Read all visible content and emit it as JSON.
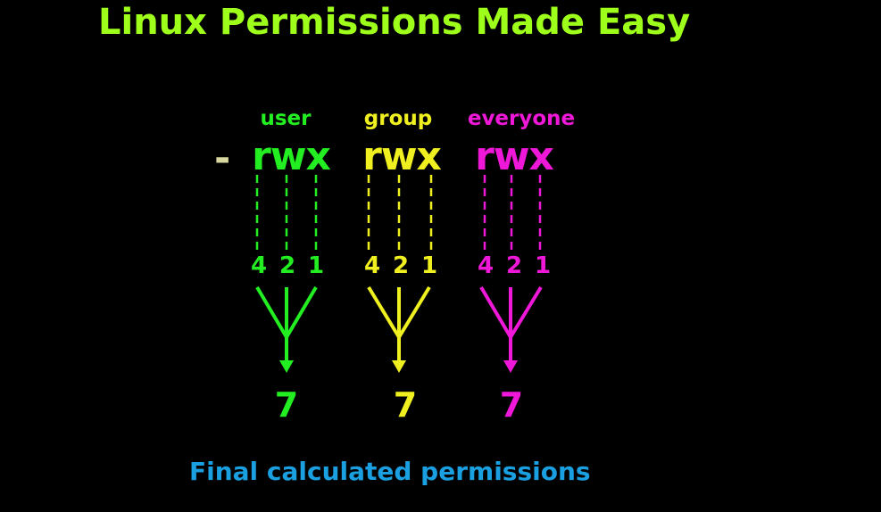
{
  "title": "Linux Permissions Made Easy",
  "file_type_dash": "-",
  "footer": "Final calculated permissions",
  "colors": {
    "background": "#000000",
    "title": "#9eff1a",
    "user": "#22ee22",
    "group": "#f0f020",
    "everyone": "#f018d8",
    "footer": "#1a9fe0",
    "dash": "#d8d8a0"
  },
  "groups": [
    {
      "key": "user",
      "label": "user",
      "symbols": "rwx",
      "values": [
        "4",
        "2",
        "1"
      ],
      "total": "7"
    },
    {
      "key": "group",
      "label": "group",
      "symbols": "rwx",
      "values": [
        "4",
        "2",
        "1"
      ],
      "total": "7"
    },
    {
      "key": "everyone",
      "label": "everyone",
      "symbols": "rwx",
      "values": [
        "4",
        "2",
        "1"
      ],
      "total": "7"
    }
  ]
}
